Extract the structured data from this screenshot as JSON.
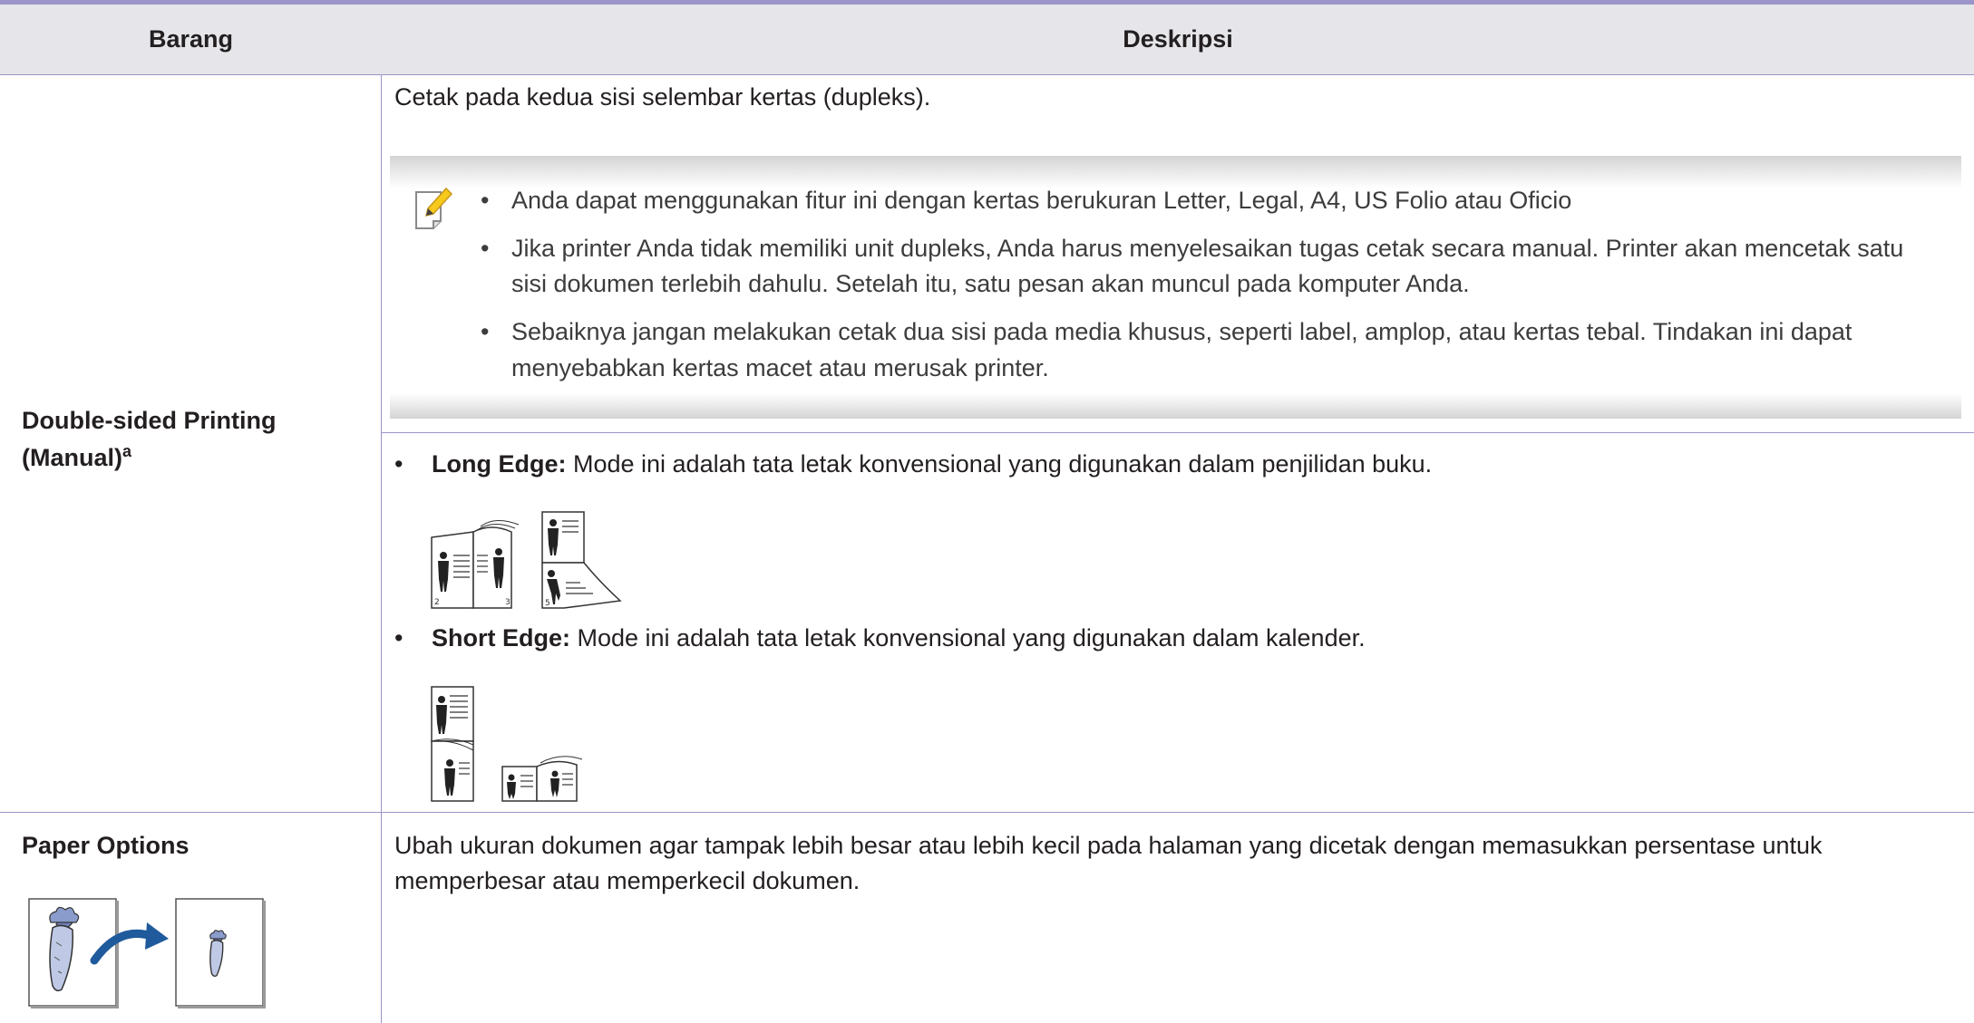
{
  "table": {
    "header": {
      "col1": "Barang",
      "col2": "Deskripsi"
    }
  },
  "row1": {
    "item_label": "Double-sided Printing",
    "item_label_line2": "(Manual)",
    "item_superscript": "a",
    "intro": "Cetak pada kedua sisi selembar kertas (dupleks).",
    "notes": [
      "Anda dapat menggunakan fitur ini dengan kertas berukuran Letter, Legal, A4, US Folio atau Oficio",
      "Jika printer Anda tidak memiliki unit dupleks, Anda harus menyelesaikan tugas cetak secara manual. Printer akan mencetak satu sisi dokumen terlebih dahulu. Setelah itu, satu pesan akan muncul pada komputer Anda.",
      "Sebaiknya jangan melakukan cetak dua sisi pada media khusus, seperti label, amplop, atau kertas tebal. Tindakan ini dapat menyebabkan kertas macet atau merusak printer."
    ],
    "long_edge": {
      "term": "Long Edge:",
      "desc": " Mode ini adalah tata letak konvensional yang digunakan dalam penjilidan buku."
    },
    "short_edge": {
      "term": "Short Edge:",
      "desc": " Mode ini adalah tata letak konvensional yang digunakan dalam kalender."
    },
    "diagram_numbers": {
      "p2": "2",
      "p3": "3",
      "p5": "5"
    }
  },
  "row2": {
    "item_label": "Paper Options",
    "desc": "Ubah ukuran dokumen agar tampak lebih besar atau lebih kecil pada halaman yang dicetak dengan memasukkan persentase untuk memperbesar atau memperkecil dokumen."
  },
  "icons": {
    "note": "note-pencil-icon",
    "long_edge": "long-edge-binding-icon",
    "short_edge": "short-edge-binding-icon",
    "scale": "paper-scale-icon"
  },
  "colors": {
    "rule": "#9b95c9",
    "header_bg": "#e6e6ea",
    "arrow": "#1f5a9c"
  }
}
